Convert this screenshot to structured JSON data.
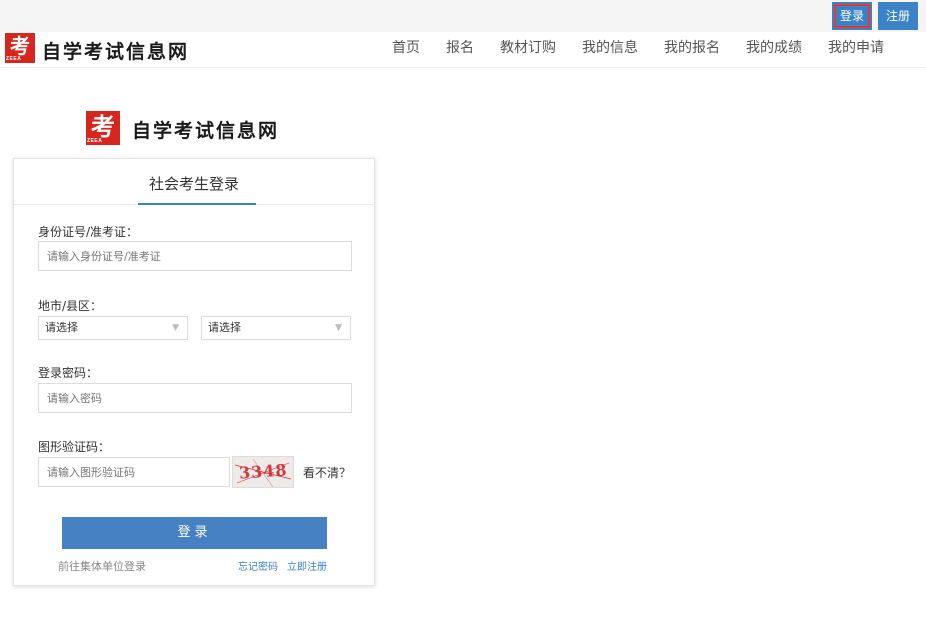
{
  "top_bar": {
    "login_label": "登录",
    "register_label": "注册"
  },
  "header": {
    "logo_glyph": "考",
    "logo_sub": "ZEEA",
    "site_name": "自学考试信息网",
    "nav": [
      "首页",
      "报名",
      "教材订购",
      "我的信息",
      "我的报名",
      "我的成绩",
      "我的申请"
    ]
  },
  "brand": {
    "logo_glyph": "考",
    "logo_sub": "ZEEA",
    "site_name": "自学考试信息网"
  },
  "login": {
    "title": "社会考生登录",
    "id_label": "身份证号/准考证：",
    "id_placeholder": "请输入身份证号/准考证",
    "region_label": "地市/县区：",
    "city_value": "请选择",
    "district_value": "请选择",
    "password_label": "登录密码：",
    "password_placeholder": "请输入密码",
    "captcha_label": "图形验证码：",
    "captcha_placeholder": "请输入图形验证码",
    "captcha_text": "3348",
    "refresh_label": "看不清？",
    "submit_label": "登录",
    "group_login_link": "前往集体单位登录",
    "forgot_link": "忘记密码",
    "register_link": "立即注册"
  },
  "colors": {
    "accent": "#3b82c6",
    "brand_red": "#d7261e",
    "highlight_outline": "#e53935"
  }
}
